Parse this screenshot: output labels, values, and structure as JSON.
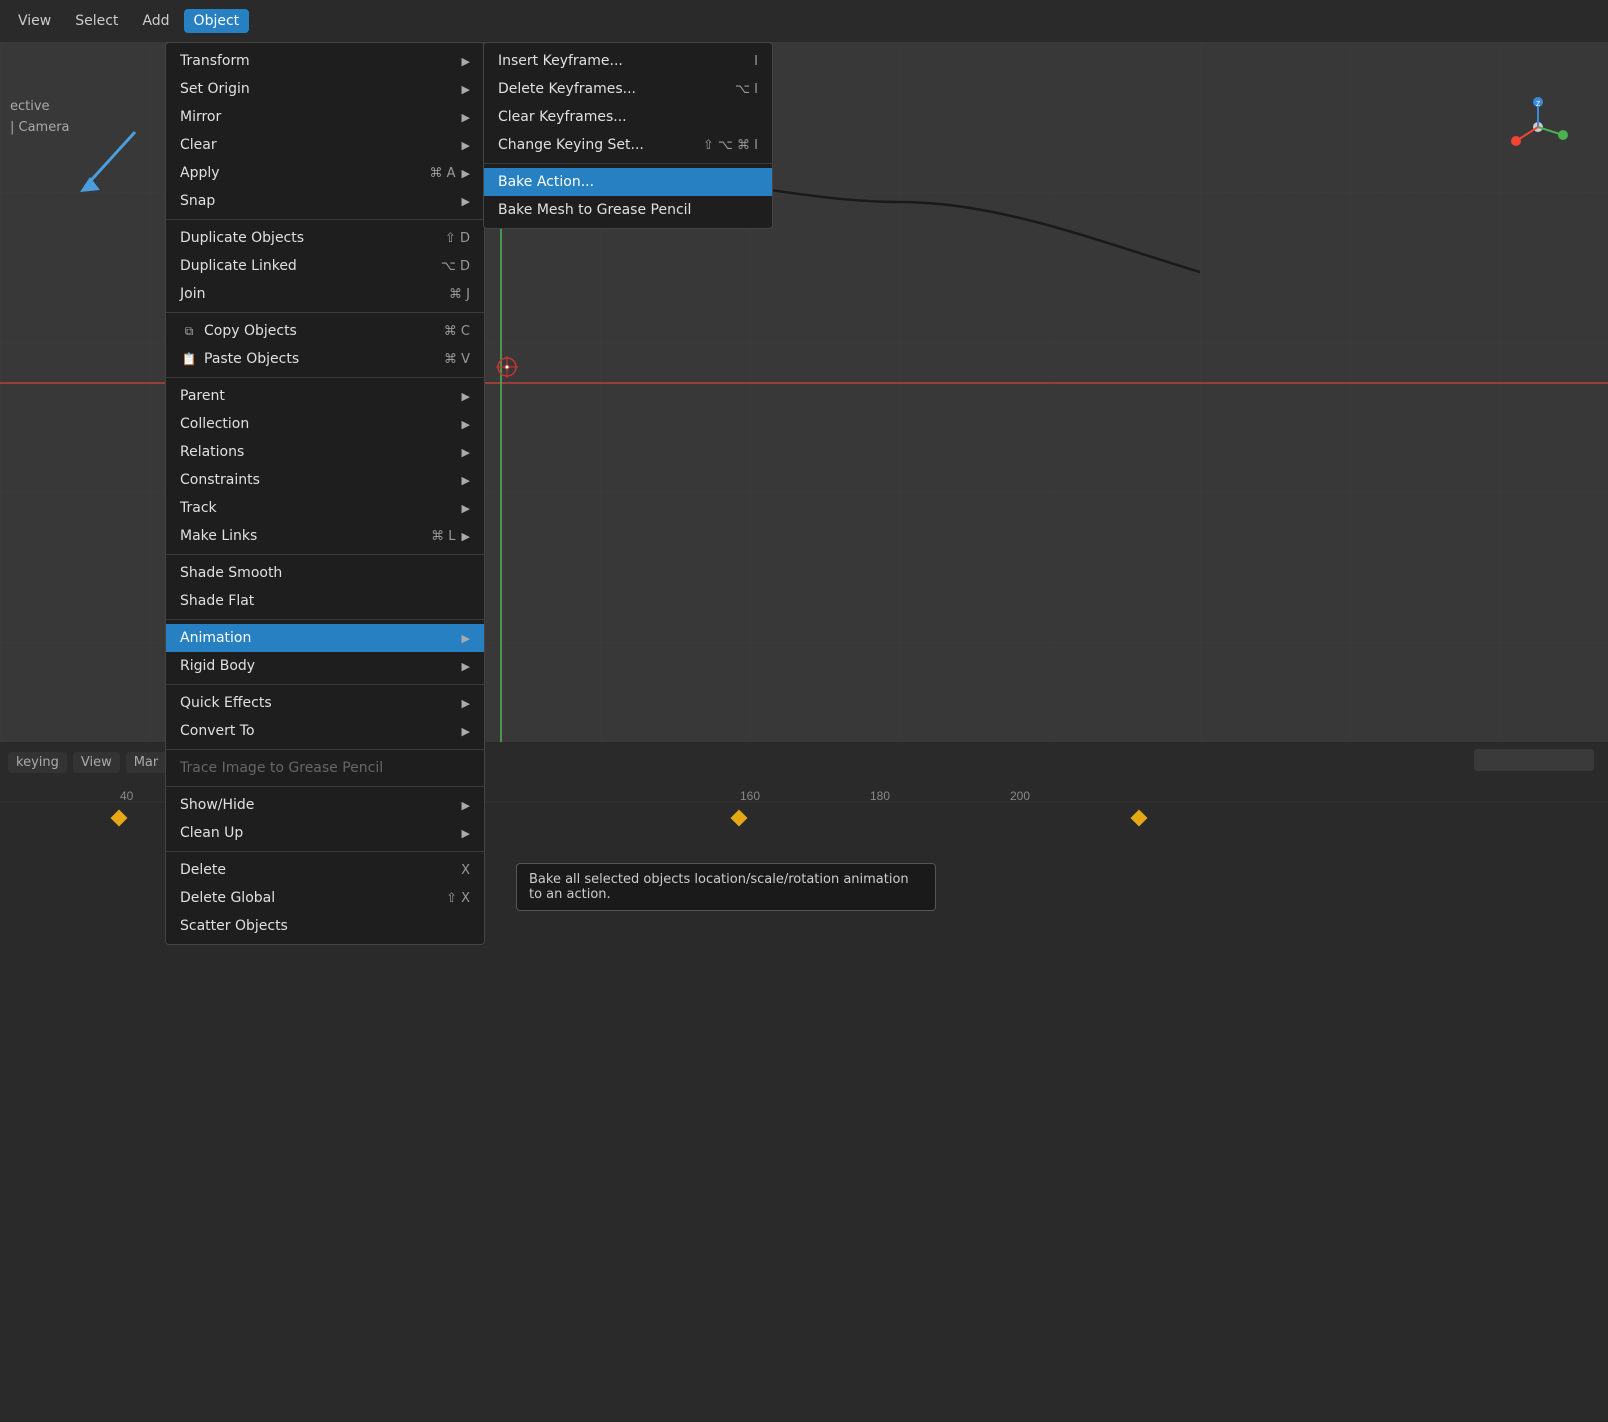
{
  "menubar": {
    "items": [
      {
        "label": "View",
        "active": false
      },
      {
        "label": "Select",
        "active": false
      },
      {
        "label": "Add",
        "active": false
      },
      {
        "label": "Object",
        "active": true
      }
    ]
  },
  "viewport": {
    "info_line1": "ective",
    "info_line2": "| Camera",
    "background": "#383838"
  },
  "object_menu": {
    "items": [
      {
        "label": "Transform",
        "shortcut": "",
        "has_submenu": true,
        "disabled": false
      },
      {
        "label": "Set Origin",
        "shortcut": "",
        "has_submenu": true,
        "disabled": false
      },
      {
        "label": "Mirror",
        "shortcut": "",
        "has_submenu": true,
        "disabled": false
      },
      {
        "label": "Clear",
        "shortcut": "",
        "has_submenu": true,
        "disabled": false
      },
      {
        "label": "Apply",
        "shortcut": "⌘ A",
        "has_submenu": true,
        "disabled": false
      },
      {
        "label": "Snap",
        "shortcut": "",
        "has_submenu": true,
        "disabled": false
      },
      {
        "separator": true
      },
      {
        "label": "Duplicate Objects",
        "shortcut": "⇧ D",
        "has_submenu": false,
        "disabled": false
      },
      {
        "label": "Duplicate Linked",
        "shortcut": "⌥ D",
        "has_submenu": false,
        "disabled": false
      },
      {
        "label": "Join",
        "shortcut": "⌘ J",
        "has_submenu": false,
        "disabled": false
      },
      {
        "separator": true
      },
      {
        "label": "Copy Objects",
        "shortcut": "⌘ C",
        "has_submenu": false,
        "disabled": false,
        "has_icon": true
      },
      {
        "label": "Paste Objects",
        "shortcut": "⌘ V",
        "has_submenu": false,
        "disabled": false,
        "has_icon": true
      },
      {
        "separator": true
      },
      {
        "label": "Parent",
        "shortcut": "",
        "has_submenu": true,
        "disabled": false
      },
      {
        "label": "Collection",
        "shortcut": "",
        "has_submenu": true,
        "disabled": false
      },
      {
        "label": "Relations",
        "shortcut": "",
        "has_submenu": true,
        "disabled": false
      },
      {
        "label": "Constraints",
        "shortcut": "",
        "has_submenu": true,
        "disabled": false
      },
      {
        "label": "Track",
        "shortcut": "",
        "has_submenu": true,
        "disabled": false
      },
      {
        "label": "Make Links",
        "shortcut": "⌘ L",
        "has_submenu": true,
        "disabled": false
      },
      {
        "separator": true
      },
      {
        "label": "Shade Smooth",
        "shortcut": "",
        "has_submenu": false,
        "disabled": false
      },
      {
        "label": "Shade Flat",
        "shortcut": "",
        "has_submenu": false,
        "disabled": false
      },
      {
        "separator": true
      },
      {
        "label": "Animation",
        "shortcut": "",
        "has_submenu": true,
        "disabled": false,
        "highlighted": true
      },
      {
        "label": "Rigid Body",
        "shortcut": "",
        "has_submenu": true,
        "disabled": false
      },
      {
        "separator": true
      },
      {
        "label": "Quick Effects",
        "shortcut": "",
        "has_submenu": true,
        "disabled": false
      },
      {
        "label": "Convert To",
        "shortcut": "",
        "has_submenu": true,
        "disabled": false
      },
      {
        "separator": true
      },
      {
        "label": "Trace Image to Grease Pencil",
        "shortcut": "",
        "has_submenu": false,
        "disabled": true
      },
      {
        "separator": true
      },
      {
        "label": "Show/Hide",
        "shortcut": "",
        "has_submenu": true,
        "disabled": false
      },
      {
        "label": "Clean Up",
        "shortcut": "",
        "has_submenu": true,
        "disabled": false
      },
      {
        "separator": true
      },
      {
        "label": "Delete",
        "shortcut": "X",
        "has_submenu": false,
        "disabled": false
      },
      {
        "label": "Delete Global",
        "shortcut": "⇧ X",
        "has_submenu": false,
        "disabled": false
      },
      {
        "label": "Scatter Objects",
        "shortcut": "",
        "has_submenu": false,
        "disabled": false
      }
    ]
  },
  "animation_submenu": {
    "items": [
      {
        "label": "Insert Keyframe...",
        "shortcut": "I",
        "highlighted": false
      },
      {
        "label": "Delete Keyframes...",
        "shortcut": "⌥ I",
        "highlighted": false
      },
      {
        "label": "Clear Keyframes...",
        "shortcut": "",
        "highlighted": false
      },
      {
        "label": "Change Keying Set...",
        "shortcut": "⇧ ⌥ ⌘ I",
        "highlighted": false
      },
      {
        "separator": true
      },
      {
        "label": "Bake Action...",
        "shortcut": "",
        "highlighted": true
      },
      {
        "label": "Bake Mesh to Grease Pencil",
        "shortcut": "",
        "highlighted": false
      }
    ]
  },
  "tooltip": {
    "text": "Bake all selected objects location/scale/rotation animation to an action."
  },
  "timeline": {
    "labels": [
      "keying",
      "View",
      "Mar"
    ],
    "numbers": [
      "40",
      "160",
      "180",
      "200"
    ]
  }
}
